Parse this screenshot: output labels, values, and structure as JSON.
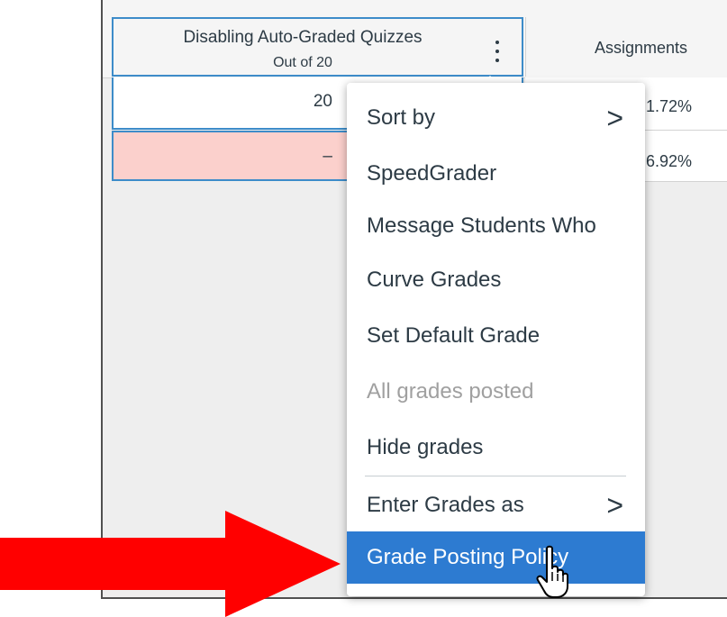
{
  "column_header": {
    "title": "Disabling Auto-Graded Quizzes",
    "subtitle": "Out of 20"
  },
  "assignments_header": {
    "label": "Assignments"
  },
  "rows": [
    {
      "score": "20",
      "assignments_pct": "1.72%"
    },
    {
      "score": "–",
      "assignments_pct": "6.92%"
    }
  ],
  "menu": {
    "items": [
      {
        "label": "Sort by",
        "submenu": true
      },
      {
        "label": "SpeedGrader"
      },
      {
        "label": "Message Students Who"
      },
      {
        "label": "Curve Grades"
      },
      {
        "label": "Set Default Grade"
      },
      {
        "label": "All grades posted",
        "disabled": true
      },
      {
        "label": "Hide grades"
      },
      {
        "label": "Enter Grades as",
        "submenu": true
      },
      {
        "label": "Grade Posting Policy",
        "highlighted": true
      }
    ],
    "chevron": ">"
  },
  "icons": {
    "kebab": "vertical-ellipsis-icon",
    "chevron": "chevron-right-icon",
    "pointer": "hand-pointer-icon",
    "annotation": "red-arrow"
  },
  "colors": {
    "accent_blue": "#2d7bd1",
    "border_blue": "#3d8cc9",
    "missing_row_pink": "#fbd0cc",
    "arrow_red": "#ff0000"
  }
}
